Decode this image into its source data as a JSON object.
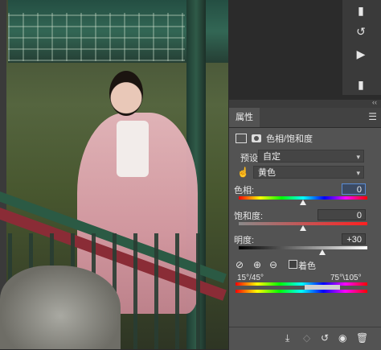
{
  "toolstrip": {
    "icons": [
      "adjust-icon",
      "rotate-icon",
      "play-icon",
      "more-icon"
    ]
  },
  "panel": {
    "tab_label": "属性",
    "title": "色相/饱和度",
    "preset_label": "预设:",
    "preset_value": "自定",
    "channel_value": "黄色",
    "hue_label": "色相:",
    "hue_value": "0",
    "saturation_label": "饱和度:",
    "saturation_value": "0",
    "lightness_label": "明度:",
    "lightness_value": "+30",
    "colorize_label": "着色",
    "range_left": "15°/45°",
    "range_right": "75°\\105°",
    "hue_level": 0.5,
    "saturation_level": 0.5,
    "lightness_level": 0.65
  }
}
